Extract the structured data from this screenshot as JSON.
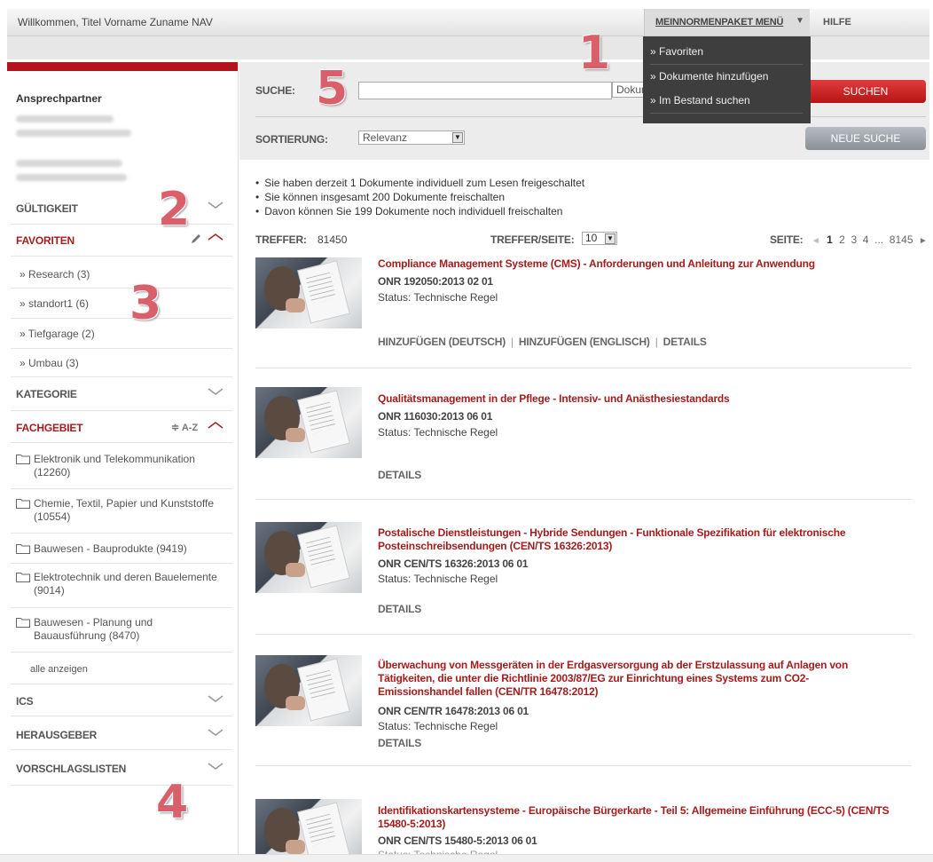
{
  "topbar": {
    "welcome": "Willkommen, Titel Vorname Zuname NAV",
    "menu_label": "MEINNORMENPAKET MENÜ",
    "menu_arrow": "▼",
    "help": "HILFE"
  },
  "dropdown": {
    "items": [
      "» Favoriten",
      "» Dokumente hinzufügen",
      "» Im Bestand suchen"
    ]
  },
  "sidebar": {
    "contact_title": "Ansprechpartner",
    "sections": {
      "gueltigkeit": "GÜLTIGKEIT",
      "favoriten": "FAVORITEN",
      "kategorie": "KATEGORIE",
      "fachgebiet": "FACHGEBIET",
      "fachgebiet_sort": "≑ A-Z",
      "ics": "ICS",
      "herausgeber": "HERAUSGEBER",
      "vorschlagslisten": "VORSCHLAGSLISTEN"
    },
    "favoriten_items": [
      "» Research (3)",
      "» standort1 (6)",
      "» Tiefgarage (2)",
      "» Umbau (3)"
    ],
    "fachgebiet_items": [
      "Elektronik und Telekommunikation (12260)",
      "Chemie, Textil, Papier und Kunststoffe (10554)",
      "Bauwesen - Bauprodukte (9419)",
      "Elektrotechnik und deren Bauelemente (9014)",
      "Bauwesen - Planung und Bauausführung (8470)"
    ],
    "show_all": "alle anzeigen"
  },
  "search": {
    "label": "SUCHE:",
    "value": "",
    "doctype_placeholder": "Dokumentenauswahl",
    "search_button": "SUCHEN",
    "sort_label": "SORTIERUNG:",
    "sort_value": "Relevanz",
    "new_search_button": "NEUE SUCHE"
  },
  "info": [
    "Sie haben derzeit 1 Dokumente individuell zum Lesen freigeschaltet",
    "Sie können insgesamt 200 Dokumente freischalten",
    "Davon können Sie 199 Dokumente noch individuell freischalten"
  ],
  "results_meta": {
    "hits_label": "TREFFER:",
    "hits_value": "81450",
    "perpage_label": "TREFFER/SEITE:",
    "perpage_value": "10",
    "page_label": "SEITE:",
    "page_prev": "◄",
    "page_current": "1",
    "pages": "2  3  4  ...  8145",
    "page_next": "►"
  },
  "results": [
    {
      "title": "Compliance Management Systeme (CMS) - Anforderungen und Anleitung zur Anwendung",
      "code": "ONR 192050:2013 02 01",
      "status": "Status: Technische Regel",
      "add_de": "HINZUFÜGEN (DEUTSCH)",
      "add_en": "HINZUFÜGEN (ENGLISCH)",
      "details": "DETAILS"
    },
    {
      "title": "Qualitätsmanagement in der Pflege - Intensiv- und Anästhesiestandards",
      "code": "ONR 116030:2013 06 01",
      "status": "Status: Technische Regel",
      "details": "DETAILS"
    },
    {
      "title": "Postalische Dienstleistungen - Hybride Sendungen - Funktionale Spezifikation für elektronische Posteinschreibsendungen (CEN/TS 16326:2013)",
      "code": "ONR CEN/TS 16326:2013 06 01",
      "status": "Status: Technische Regel",
      "details": "DETAILS"
    },
    {
      "title": "Überwachung von Messgeräten in der Erdgasversorgung ab der Erstzulassung auf Anlagen von Tätigkeiten, die unter die Richtlinie 2003/87/EG zur Einrichtung eines Systems zum CO2-Emissionshandel fallen (CEN/TR 16478:2012)",
      "code": "ONR CEN/TR 16478:2013 06 01",
      "status": "Status: Technische Regel",
      "details": "DETAILS"
    },
    {
      "title": "Identifikationskartensysteme - Europäische Bürgerkarte - Teil 5: Allgemeine Einführung (ECC-5) (CEN/TS 15480-5:2013)",
      "code": "ONR CEN/TS 15480-5:2013 06 01",
      "status": "Status: Technische Regel"
    }
  ],
  "annotations": [
    "1",
    "2",
    "3",
    "4",
    "5"
  ]
}
